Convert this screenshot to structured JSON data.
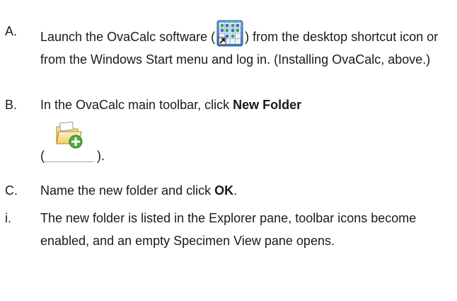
{
  "steps": [
    {
      "marker": "A.",
      "text_before_icon": "Launch the OvaCalc software (",
      "icon": "ovacalc-app-icon",
      "text_after_icon": ") from the desktop shortcut icon or from the Windows Start menu and log in. (Installing OvaCalc, above.)"
    },
    {
      "marker": "B.",
      "text_before_bold": "In the OvaCalc main toolbar, click ",
      "bold": "New Folder",
      "paren_open": "(",
      "icon": "new-folder-icon",
      "paren_close": ")."
    },
    {
      "marker": "C.",
      "text_before_bold": "Name the new folder and click ",
      "bold": "OK",
      "text_after_bold": "."
    },
    {
      "marker": "i.",
      "text": "The new folder is listed in the Explorer pane, toolbar icons become enabled, and an empty Specimen View pane opens."
    }
  ]
}
